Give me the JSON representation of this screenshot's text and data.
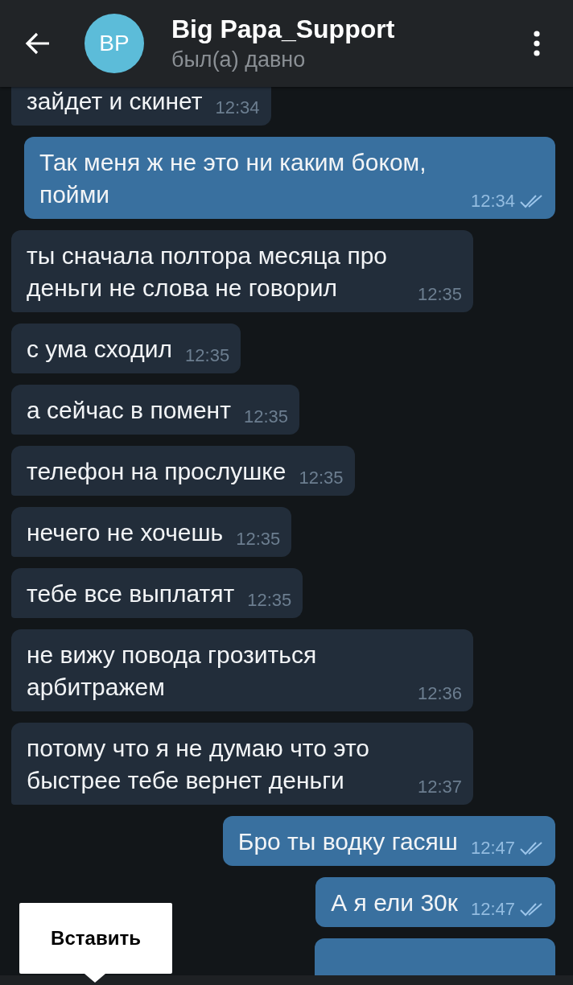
{
  "header": {
    "avatar_initials": "BP",
    "title": "Big Papa_Support",
    "status": "был(а) давно"
  },
  "messages": [
    {
      "outgoing": false,
      "text": "зайдет и скинет",
      "time": "12:34"
    },
    {
      "outgoing": true,
      "text": "Так меня ж не это ни каким боком, пойми",
      "time": "12:34",
      "read": true
    },
    {
      "outgoing": false,
      "text": "ты сначала полтора месяца про деньги не слова не говорил",
      "time": "12:35"
    },
    {
      "outgoing": false,
      "text": "с ума сходил",
      "time": "12:35"
    },
    {
      "outgoing": false,
      "text": "а сейчас в помент",
      "time": "12:35"
    },
    {
      "outgoing": false,
      "text": "телефон на прослушке",
      "time": "12:35"
    },
    {
      "outgoing": false,
      "text": "нечего не хочешь",
      "time": "12:35"
    },
    {
      "outgoing": false,
      "text": "тебе все выплатят",
      "time": "12:35"
    },
    {
      "outgoing": false,
      "text": "не вижу повода грозиться арбитражем",
      "time": "12:36"
    },
    {
      "outgoing": false,
      "text": "потому что я не думаю что это быстрее тебе вернет деньги",
      "time": "12:37"
    },
    {
      "outgoing": true,
      "text": "Бро ты водку гасяш",
      "time": "12:47",
      "read": true
    },
    {
      "outgoing": true,
      "text": "А я ели 30к",
      "time": "12:47",
      "read": true
    },
    {
      "outgoing": true
    }
  ],
  "popup": {
    "label": "Вставить"
  }
}
